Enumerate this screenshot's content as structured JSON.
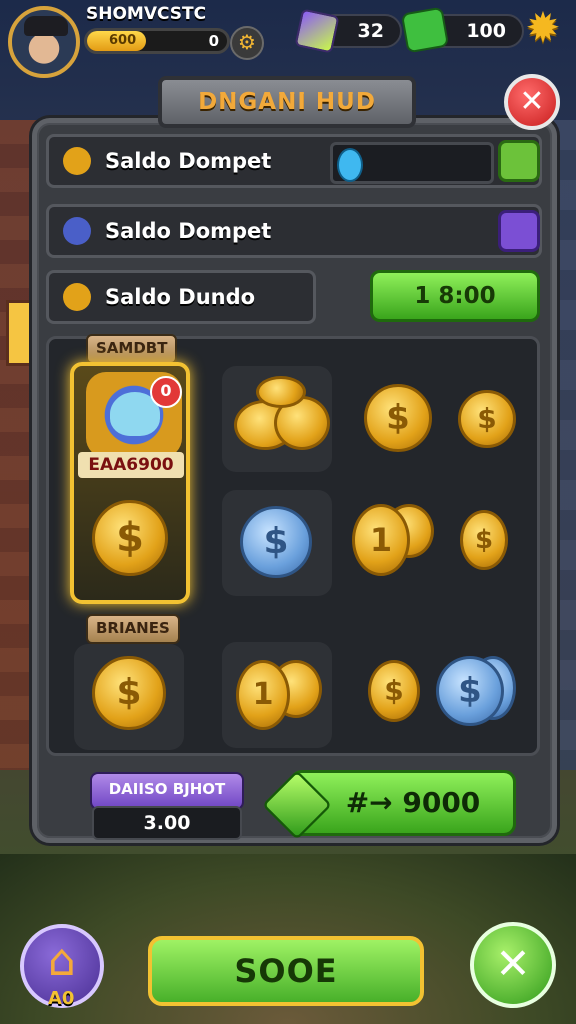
{
  "player": {
    "name": "SHOMVCSTC",
    "xp_label": "600",
    "xp_value": "0",
    "xp_progress": 0.42
  },
  "resources": {
    "gems": "32",
    "cash": "100"
  },
  "dialog": {
    "title": "DNGANI HUD",
    "rows": [
      {
        "label": "Saldo Dompet"
      },
      {
        "label": "Saldo Dompet"
      },
      {
        "label": "Saldo Dundo"
      }
    ],
    "timer": "1 8:00"
  },
  "shop": {
    "section_top": "SAMDBT",
    "featured_label": "EAA6900",
    "featured_badge": "0",
    "section_bottom": "BRIANES",
    "coin_symbols": {
      "dollar": "$",
      "one": "1"
    }
  },
  "bottom": {
    "tag": "DAIISO BJHOT",
    "value": "3.00",
    "convert_label": "#→ 9000"
  },
  "footer": {
    "home_label": "A0",
    "save_label": "SOOE",
    "action_glyph": "✕"
  },
  "icons": [
    "settings-gear-icon",
    "gem-icon",
    "cash-icon",
    "star-icon",
    "close-icon",
    "home-icon"
  ]
}
